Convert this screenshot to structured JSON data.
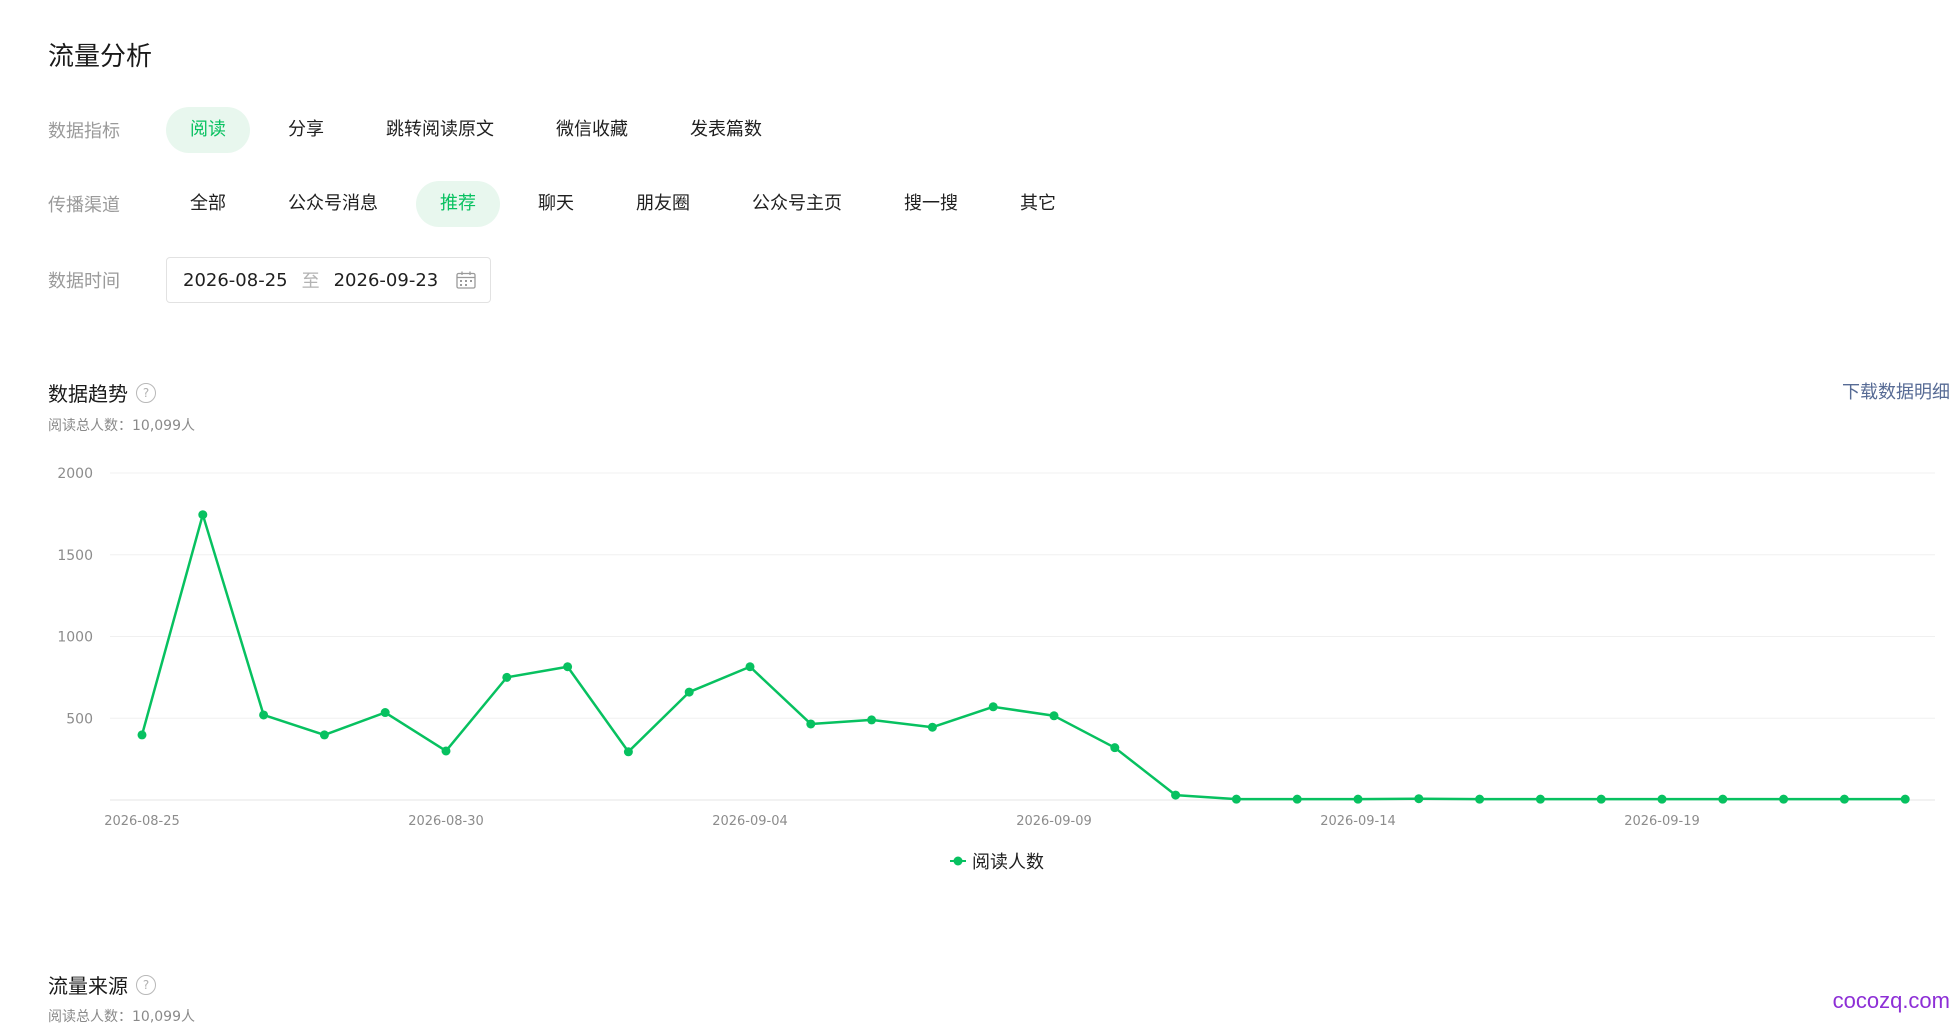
{
  "page": {
    "title": "流量分析"
  },
  "filters": {
    "metric": {
      "label": "数据指标",
      "options": [
        "阅读",
        "分享",
        "跳转阅读原文",
        "微信收藏",
        "发表篇数"
      ],
      "selected": "阅读"
    },
    "channel": {
      "label": "传播渠道",
      "options": [
        "全部",
        "公众号消息",
        "推荐",
        "聊天",
        "朋友圈",
        "公众号主页",
        "搜一搜",
        "其它"
      ],
      "selected": "推荐"
    },
    "date": {
      "label": "数据时间",
      "start": "2026-08-25",
      "separator": "至",
      "end": "2026-09-23",
      "icon": "calendar-icon"
    }
  },
  "trend": {
    "title": "数据趋势",
    "help_icon": "?",
    "subtitle": "阅读总人数：10,099人",
    "download_label": "下载数据明细"
  },
  "source": {
    "title": "流量来源",
    "help_icon": "?",
    "subtitle": "阅读总人数：10,099人"
  },
  "watermark": "cocozq.com",
  "colors": {
    "accent": "#07c160",
    "active_pill_bg": "#e8f7ee",
    "link": "#576b95",
    "watermark": "#8d2fd6"
  },
  "chart_data": {
    "type": "line",
    "x": [
      "2026-08-25",
      "2026-08-26",
      "2026-08-27",
      "2026-08-28",
      "2026-08-29",
      "2026-08-30",
      "2026-08-31",
      "2026-09-01",
      "2026-09-02",
      "2026-09-03",
      "2026-09-04",
      "2026-09-05",
      "2026-09-06",
      "2026-09-07",
      "2026-09-08",
      "2026-09-09",
      "2026-09-10",
      "2026-09-11",
      "2026-09-12",
      "2026-09-13",
      "2026-09-14",
      "2026-09-15",
      "2026-09-16",
      "2026-09-17",
      "2026-09-18",
      "2026-09-19",
      "2026-09-20",
      "2026-09-21",
      "2026-09-22",
      "2026-09-23"
    ],
    "x_tick_labels": [
      "2026-08-25",
      "2026-08-30",
      "2026-09-04",
      "2026-09-09",
      "2026-09-14",
      "2026-09-19"
    ],
    "y_tick_labels": [
      "500",
      "1000",
      "1500",
      "2000"
    ],
    "ylim": [
      0,
      2000
    ],
    "grid": true,
    "legend_position": "bottom-center",
    "series": [
      {
        "name": "阅读人数",
        "color": "#07c160",
        "values": [
          398,
          1745,
          520,
          398,
          535,
          300,
          750,
          815,
          295,
          660,
          815,
          465,
          490,
          445,
          570,
          515,
          320,
          30,
          5,
          5,
          5,
          8,
          5,
          5,
          5,
          5,
          5,
          5,
          5,
          5
        ]
      }
    ]
  }
}
